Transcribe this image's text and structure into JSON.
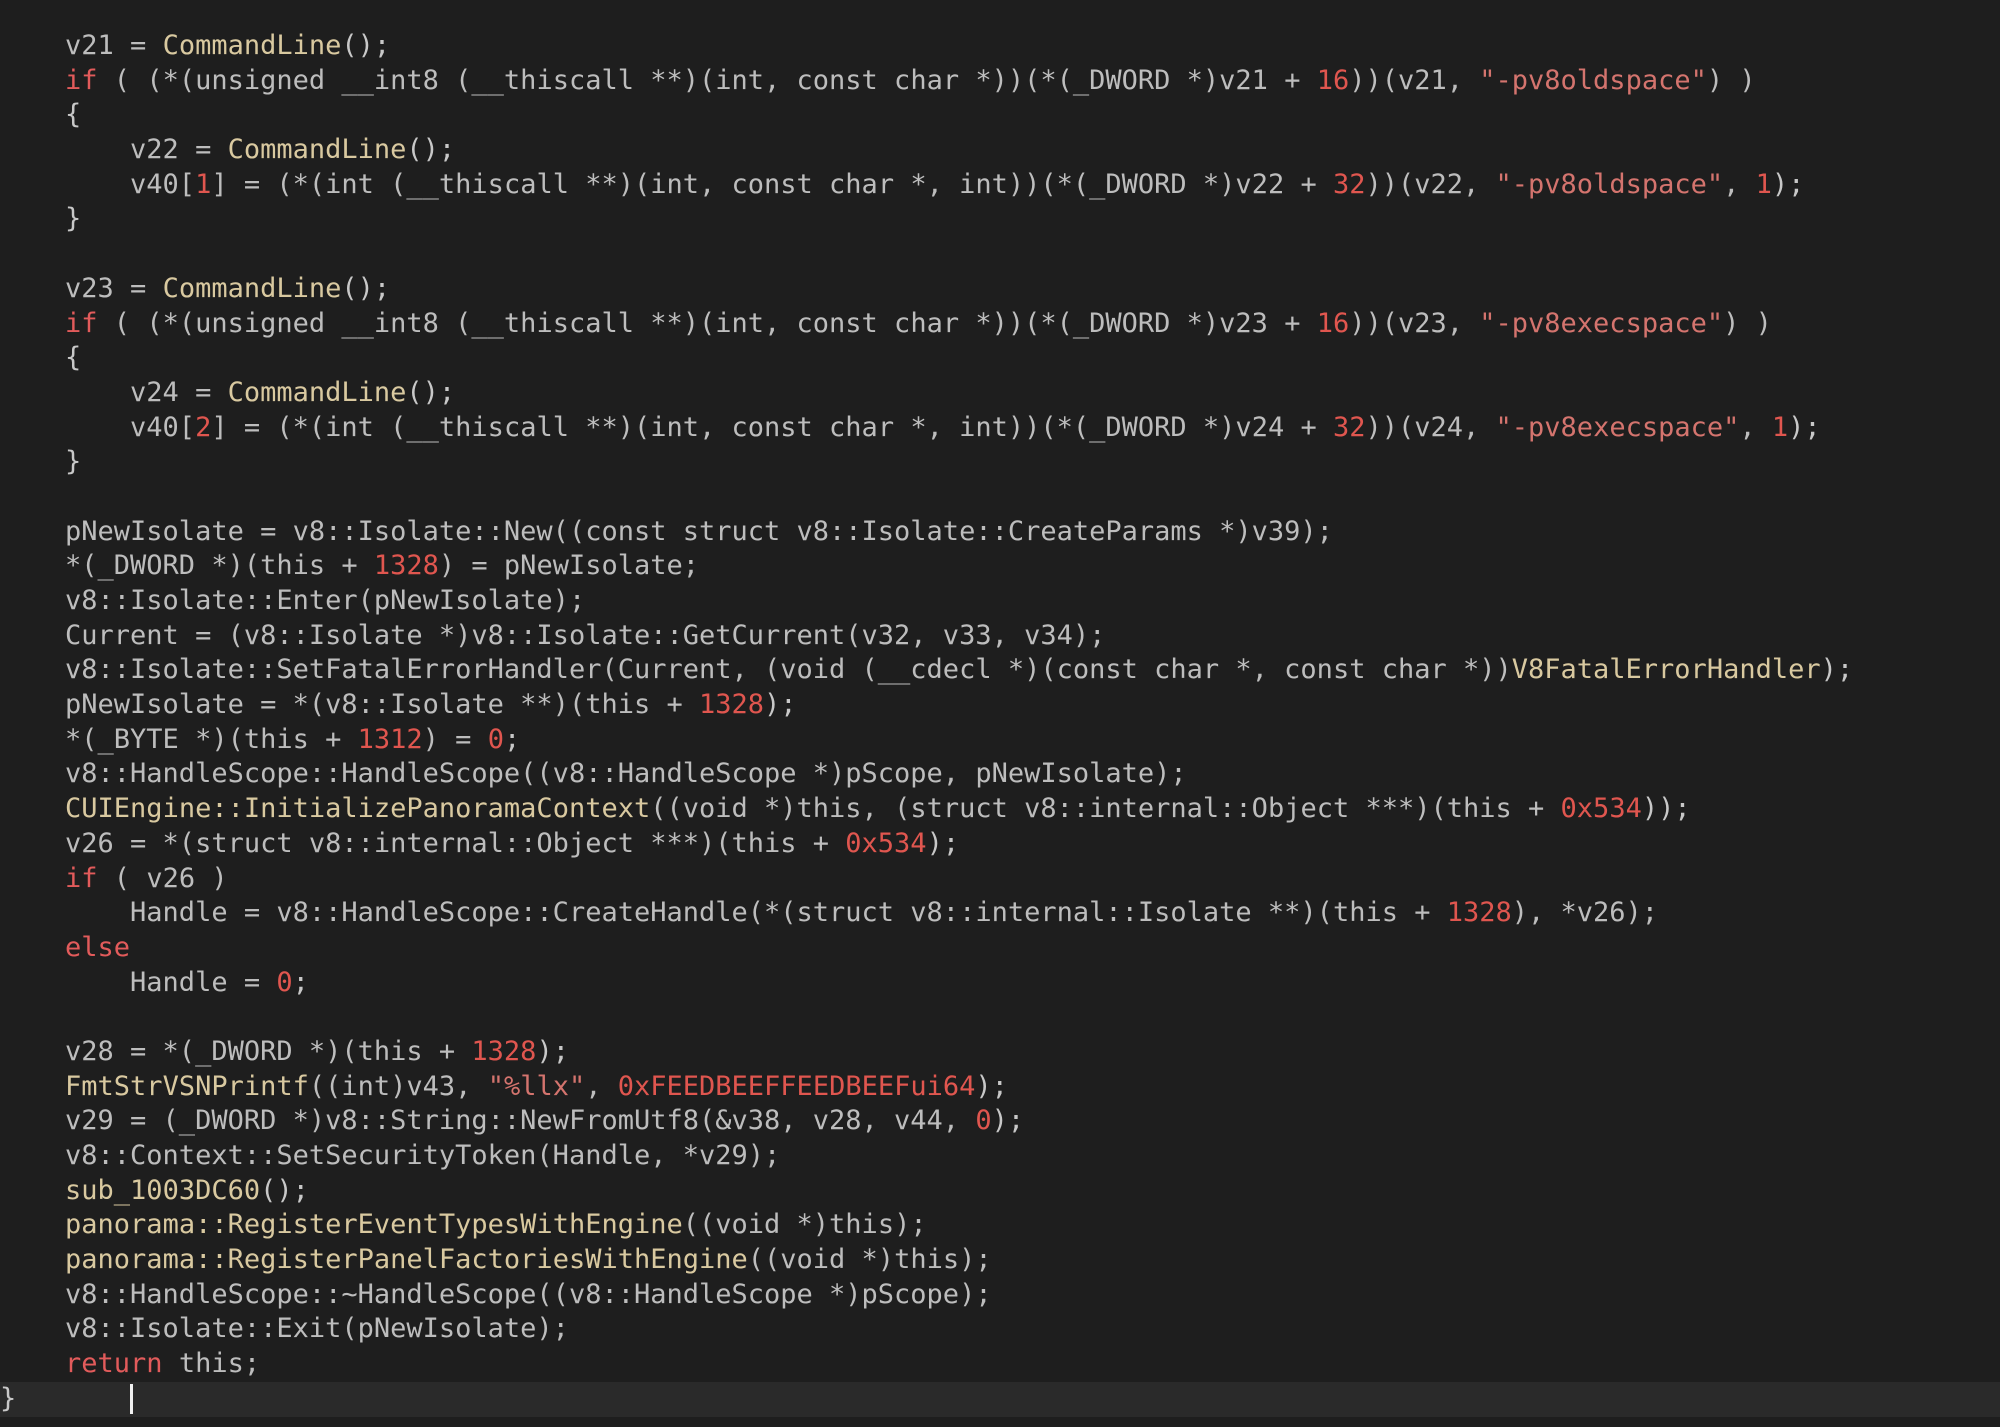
{
  "editor": {
    "lines": [
      [
        [
          "    v21 = ",
          "t-ident"
        ],
        [
          "CommandLine",
          "t-fn"
        ],
        [
          "();",
          "t-punct"
        ]
      ],
      [
        [
          "    ",
          "t-ident"
        ],
        [
          "if",
          "t-kw"
        ],
        [
          " ( (*(unsigned __int8 (__thiscall **)(int, const char *))(*(_DWORD *)v21 + ",
          "t-ident"
        ],
        [
          "16",
          "t-num"
        ],
        [
          "))(v21, ",
          "t-ident"
        ],
        [
          "\"-pv8oldspace\"",
          "t-str"
        ],
        [
          ") )",
          "t-ident"
        ]
      ],
      [
        [
          "    {",
          "t-punct"
        ]
      ],
      [
        [
          "        v22 = ",
          "t-ident"
        ],
        [
          "CommandLine",
          "t-fn"
        ],
        [
          "();",
          "t-punct"
        ]
      ],
      [
        [
          "        v40[",
          "t-ident"
        ],
        [
          "1",
          "t-num"
        ],
        [
          "] = (*(int (__thiscall **)(int, const char *, int))(*(_DWORD *)v22 + ",
          "t-ident"
        ],
        [
          "32",
          "t-num"
        ],
        [
          "))(v22, ",
          "t-ident"
        ],
        [
          "\"-pv8oldspace\"",
          "t-str"
        ],
        [
          ", ",
          "t-ident"
        ],
        [
          "1",
          "t-num"
        ],
        [
          ");",
          "t-punct"
        ]
      ],
      [
        [
          "    }",
          "t-punct"
        ]
      ],
      [
        [
          "",
          "t-ident"
        ]
      ],
      [
        [
          "    v23 = ",
          "t-ident"
        ],
        [
          "CommandLine",
          "t-fn"
        ],
        [
          "();",
          "t-punct"
        ]
      ],
      [
        [
          "    ",
          "t-ident"
        ],
        [
          "if",
          "t-kw"
        ],
        [
          " ( (*(unsigned __int8 (__thiscall **)(int, const char *))(*(_DWORD *)v23 + ",
          "t-ident"
        ],
        [
          "16",
          "t-num"
        ],
        [
          "))(v23, ",
          "t-ident"
        ],
        [
          "\"-pv8execspace\"",
          "t-str"
        ],
        [
          ") )",
          "t-ident"
        ]
      ],
      [
        [
          "    {",
          "t-punct"
        ]
      ],
      [
        [
          "        v24 = ",
          "t-ident"
        ],
        [
          "CommandLine",
          "t-fn"
        ],
        [
          "();",
          "t-punct"
        ]
      ],
      [
        [
          "        v40[",
          "t-ident"
        ],
        [
          "2",
          "t-num"
        ],
        [
          "] = (*(int (__thiscall **)(int, const char *, int))(*(_DWORD *)v24 + ",
          "t-ident"
        ],
        [
          "32",
          "t-num"
        ],
        [
          "))(v24, ",
          "t-ident"
        ],
        [
          "\"-pv8execspace\"",
          "t-str"
        ],
        [
          ", ",
          "t-ident"
        ],
        [
          "1",
          "t-num"
        ],
        [
          ");",
          "t-punct"
        ]
      ],
      [
        [
          "    }",
          "t-punct"
        ]
      ],
      [
        [
          "",
          "t-ident"
        ]
      ],
      [
        [
          "    pNewIsolate = v8::Isolate::New((const struct v8::Isolate::CreateParams *)v39);",
          "t-ident"
        ]
      ],
      [
        [
          "    *(_DWORD *)(this + ",
          "t-ident"
        ],
        [
          "1328",
          "t-num"
        ],
        [
          ") = pNewIsolate;",
          "t-ident"
        ]
      ],
      [
        [
          "    v8::Isolate::Enter(pNewIsolate);",
          "t-ident"
        ]
      ],
      [
        [
          "    Current = (v8::Isolate *)v8::Isolate::GetCurrent(v32, v33, v34);",
          "t-ident"
        ]
      ],
      [
        [
          "    v8::Isolate::SetFatalErrorHandler(Current, (void (__cdecl *)(const char *, const char *))",
          "t-ident"
        ],
        [
          "V8FatalErrorHandler",
          "t-fn"
        ],
        [
          ");",
          "t-punct"
        ]
      ],
      [
        [
          "    pNewIsolate = *(v8::Isolate **)(this + ",
          "t-ident"
        ],
        [
          "1328",
          "t-num"
        ],
        [
          ");",
          "t-punct"
        ]
      ],
      [
        [
          "    *(_BYTE *)(this + ",
          "t-ident"
        ],
        [
          "1312",
          "t-num"
        ],
        [
          ") = ",
          "t-ident"
        ],
        [
          "0",
          "t-num"
        ],
        [
          ";",
          "t-punct"
        ]
      ],
      [
        [
          "    v8::HandleScope::HandleScope((v8::HandleScope *)pScope, pNewIsolate);",
          "t-ident"
        ]
      ],
      [
        [
          "    ",
          "t-ident"
        ],
        [
          "CUIEngine::InitializePanoramaContext",
          "t-fn"
        ],
        [
          "((void *)this, (struct v8::internal::Object ***)(this + ",
          "t-ident"
        ],
        [
          "0x534",
          "t-num"
        ],
        [
          "));",
          "t-punct"
        ]
      ],
      [
        [
          "    v26 = *(struct v8::internal::Object ***)(this + ",
          "t-ident"
        ],
        [
          "0x534",
          "t-num"
        ],
        [
          ");",
          "t-punct"
        ]
      ],
      [
        [
          "    ",
          "t-ident"
        ],
        [
          "if",
          "t-kw"
        ],
        [
          " ( v26 )",
          "t-ident"
        ]
      ],
      [
        [
          "        Handle = v8::HandleScope::CreateHandle(*(struct v8::internal::Isolate **)(this + ",
          "t-ident"
        ],
        [
          "1328",
          "t-num"
        ],
        [
          "), *v26);",
          "t-ident"
        ]
      ],
      [
        [
          "    ",
          "t-ident"
        ],
        [
          "else",
          "t-kw"
        ]
      ],
      [
        [
          "        Handle = ",
          "t-ident"
        ],
        [
          "0",
          "t-num"
        ],
        [
          ";",
          "t-punct"
        ]
      ],
      [
        [
          "",
          "t-ident"
        ]
      ],
      [
        [
          "    v28 = *(_DWORD *)(this + ",
          "t-ident"
        ],
        [
          "1328",
          "t-num"
        ],
        [
          ");",
          "t-punct"
        ]
      ],
      [
        [
          "    ",
          "t-ident"
        ],
        [
          "FmtStrVSNPrintf",
          "t-fn"
        ],
        [
          "((int)v43, ",
          "t-ident"
        ],
        [
          "\"%llx\"",
          "t-str"
        ],
        [
          ", ",
          "t-ident"
        ],
        [
          "0xFEEDBEEFFEEDBEEFui64",
          "t-num"
        ],
        [
          ");",
          "t-punct"
        ]
      ],
      [
        [
          "    v29 = (_DWORD *)v8::String::NewFromUtf8(&v38, v28, v44, ",
          "t-ident"
        ],
        [
          "0",
          "t-num"
        ],
        [
          ");",
          "t-punct"
        ]
      ],
      [
        [
          "    v8::Context::SetSecurityToken(Handle, *v29);",
          "t-ident"
        ]
      ],
      [
        [
          "    ",
          "t-ident"
        ],
        [
          "sub_1003DC60",
          "t-fn"
        ],
        [
          "();",
          "t-punct"
        ]
      ],
      [
        [
          "    ",
          "t-ident"
        ],
        [
          "panorama::RegisterEventTypesWithEngine",
          "t-fn"
        ],
        [
          "((void *)this);",
          "t-ident"
        ]
      ],
      [
        [
          "    ",
          "t-ident"
        ],
        [
          "panorama::RegisterPanelFactoriesWithEngine",
          "t-fn"
        ],
        [
          "((void *)this);",
          "t-ident"
        ]
      ],
      [
        [
          "    v8::HandleScope::~HandleScope((v8::HandleScope *)pScope);",
          "t-ident"
        ]
      ],
      [
        [
          "    v8::Isolate::Exit(pNewIsolate);",
          "t-ident"
        ]
      ],
      [
        [
          "    ",
          "t-ident"
        ],
        [
          "return",
          "t-kw"
        ],
        [
          " this;",
          "t-ident"
        ]
      ],
      [
        [
          "}",
          "t-punct"
        ],
        [
          "       ",
          "t-ident"
        ]
      ]
    ],
    "current_line_index": 39,
    "colors": {
      "background": "#1e1e1e",
      "keyword": "#e25b5b",
      "number": "#e0564f",
      "string": "#d4746e",
      "function": "#d9c9a0",
      "identifier": "#bdbdbd"
    }
  }
}
